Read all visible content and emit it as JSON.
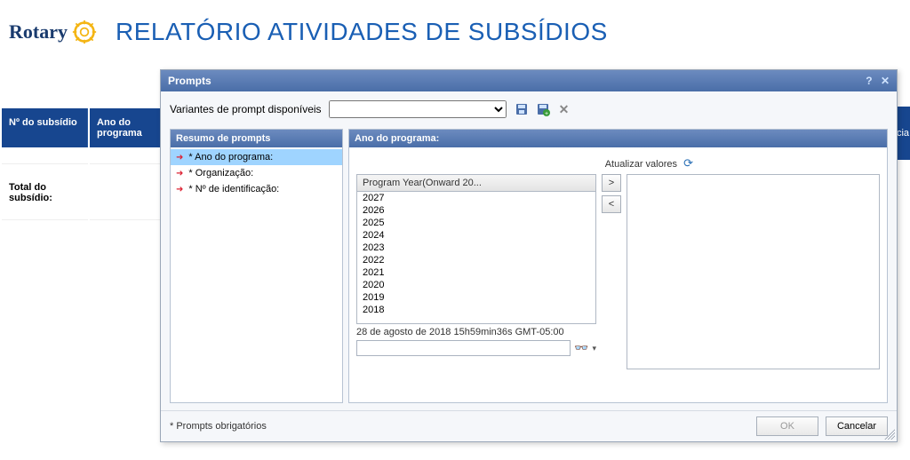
{
  "header": {
    "brand": "Rotary",
    "page_title": "RELATÓRIO ATIVIDADES DE SUBSÍDIOS"
  },
  "bg_table": {
    "col1": "Nº do subsídio",
    "col2": "Ano do programa",
    "total_label": "Total do subsídio:",
    "right_partial": "cia"
  },
  "dialog": {
    "title": "Prompts",
    "variants_label": "Variantes de prompt disponíveis",
    "prompt_summary_header": "Resumo de prompts",
    "prompts": [
      {
        "label": "* Ano do programa:",
        "selected": true
      },
      {
        "label": "* Organização:",
        "selected": false
      },
      {
        "label": "* Nº de identificação:",
        "selected": false
      }
    ],
    "right_header": "Ano do programa:",
    "refresh_label": "Atualizar valores",
    "list_title": "Program Year(Onward 20...",
    "years": [
      "2027",
      "2026",
      "2025",
      "2024",
      "2023",
      "2022",
      "2021",
      "2020",
      "2019",
      "2018"
    ],
    "timestamp": "28 de agosto de 2018 15h59min36s GMT-05:00",
    "mandatory_note": "* Prompts obrigatórios",
    "ok": "OK",
    "cancel": "Cancelar"
  }
}
